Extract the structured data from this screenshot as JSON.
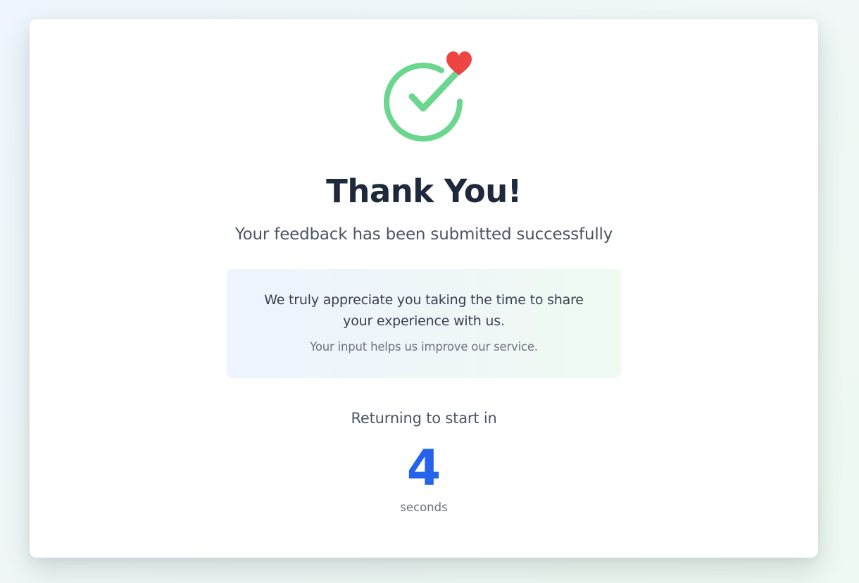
{
  "header": {
    "icon": "check-circle-icon",
    "badge_icon": "heart-icon",
    "title": "Thank You!",
    "subtitle": "Your feedback has been submitted successfully"
  },
  "message": {
    "main": "We truly appreciate you taking the time to share your experience with us.",
    "sub": "Your input helps us improve our service."
  },
  "countdown": {
    "label": "Returning to start in",
    "value": "4",
    "unit": "seconds"
  },
  "colors": {
    "check": "#6ad68e",
    "heart": "#ef4444",
    "title": "#1e293b",
    "countdown": "#2563eb"
  }
}
